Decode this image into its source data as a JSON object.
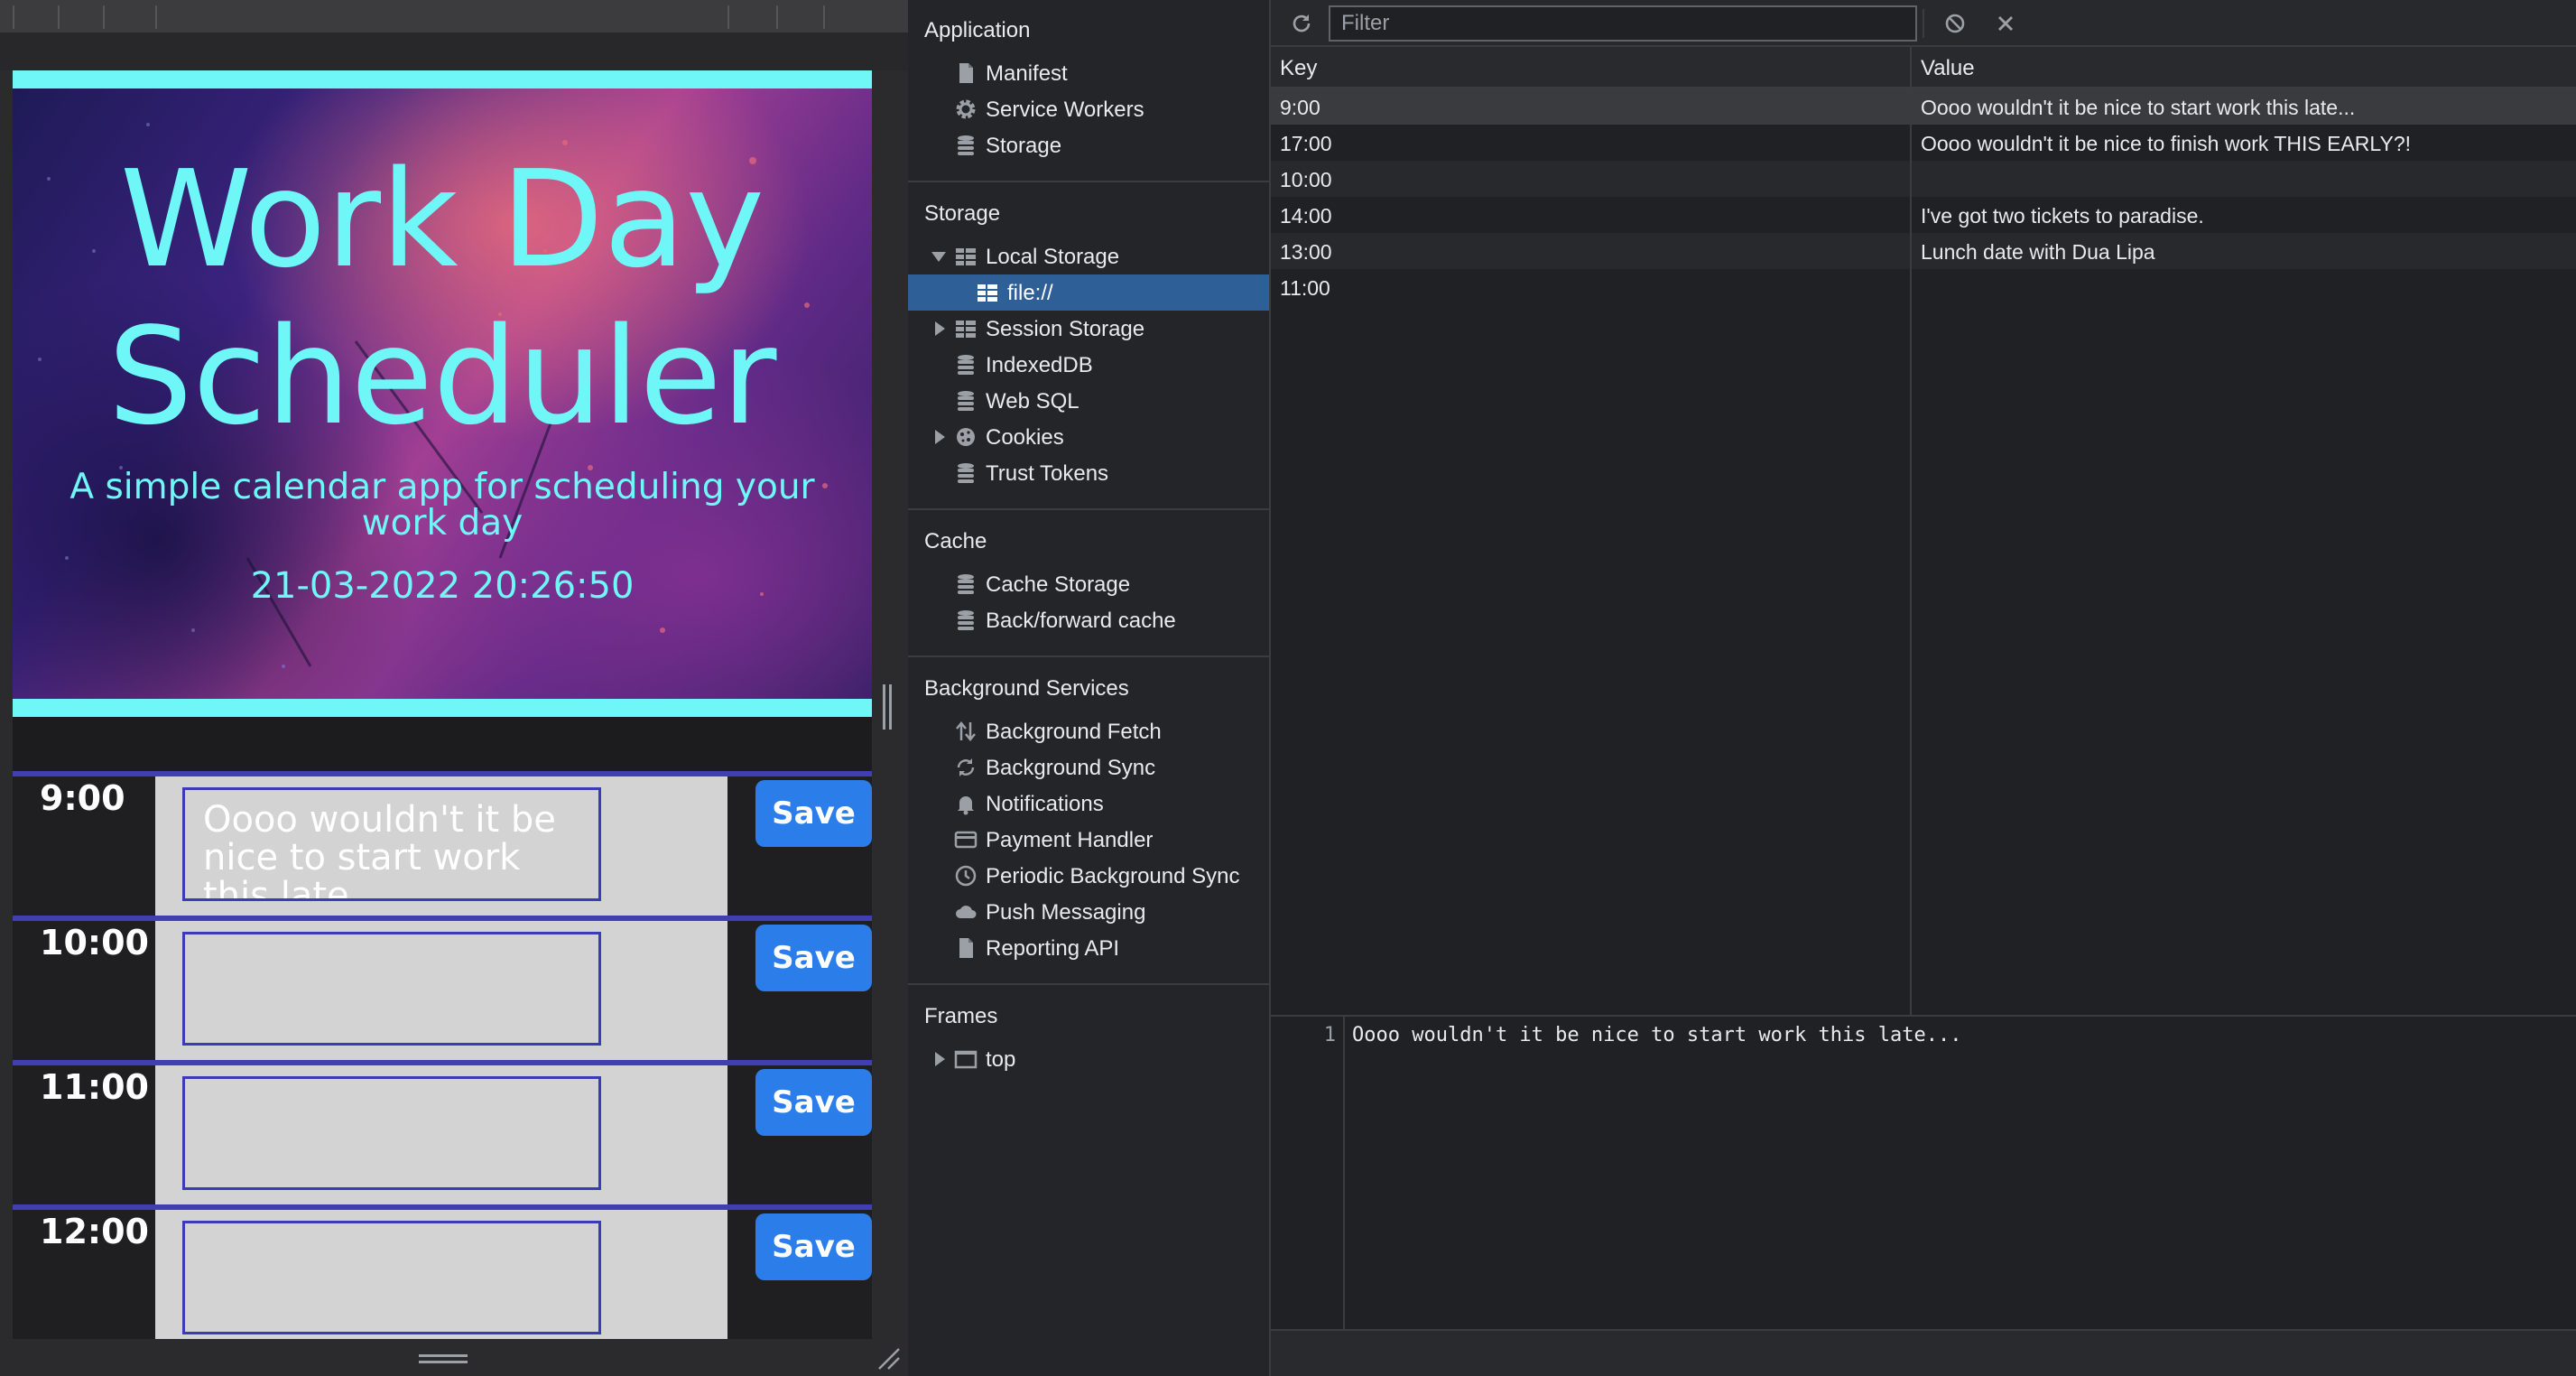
{
  "preview": {
    "hero": {
      "title_line1": "Work Day",
      "title_line2": "Scheduler",
      "subtitle": "A simple calendar app for scheduling your work day",
      "datetime": "21-03-2022 20:26:50"
    },
    "slots": [
      {
        "hour": "9:00",
        "text": "Oooo wouldn't it be nice to start work this late...",
        "save_label": "Save"
      },
      {
        "hour": "10:00",
        "text": "",
        "save_label": "Save"
      },
      {
        "hour": "11:00",
        "text": "",
        "save_label": "Save"
      },
      {
        "hour": "12:00",
        "text": "",
        "save_label": "Save"
      }
    ]
  },
  "sidebar": {
    "application": {
      "title": "Application",
      "items": [
        {
          "label": "Manifest",
          "icon": "file-icon"
        },
        {
          "label": "Service Workers",
          "icon": "gear-icon"
        },
        {
          "label": "Storage",
          "icon": "database-icon"
        }
      ]
    },
    "storage": {
      "title": "Storage",
      "local_storage": "Local Storage",
      "local_origin": "file://",
      "session_storage": "Session Storage",
      "indexeddb": "IndexedDB",
      "websql": "Web SQL",
      "cookies": "Cookies",
      "trust_tokens": "Trust Tokens"
    },
    "cache": {
      "title": "Cache",
      "items": [
        {
          "label": "Cache Storage",
          "icon": "database-icon"
        },
        {
          "label": "Back/forward cache",
          "icon": "database-icon"
        }
      ]
    },
    "background_services": {
      "title": "Background Services",
      "items": [
        {
          "label": "Background Fetch",
          "icon": "up-down-arrows-icon"
        },
        {
          "label": "Background Sync",
          "icon": "sync-icon"
        },
        {
          "label": "Notifications",
          "icon": "bell-icon"
        },
        {
          "label": "Payment Handler",
          "icon": "credit-card-icon"
        },
        {
          "label": "Periodic Background Sync",
          "icon": "clock-icon"
        },
        {
          "label": "Push Messaging",
          "icon": "cloud-icon"
        },
        {
          "label": "Reporting API",
          "icon": "file-icon"
        }
      ]
    },
    "frames": {
      "title": "Frames",
      "top": "top"
    }
  },
  "storage_view": {
    "filter_placeholder": "Filter",
    "columns": {
      "key": "Key",
      "value": "Value"
    },
    "rows": [
      {
        "key": "9:00",
        "value": "Oooo wouldn't it be nice to start work this late..."
      },
      {
        "key": "17:00",
        "value": "Oooo wouldn't it be nice to finish work THIS EARLY?!"
      },
      {
        "key": "10:00",
        "value": ""
      },
      {
        "key": "14:00",
        "value": "I've got two tickets to paradise."
      },
      {
        "key": "13:00",
        "value": "Lunch date with Dua Lipa"
      },
      {
        "key": "11:00",
        "value": ""
      }
    ],
    "selected_row": 0,
    "preview": {
      "line_number": "1",
      "text": "Oooo wouldn't it be nice to start work this late..."
    }
  },
  "colors": {
    "accent_cyan": "#6ff7f7",
    "save_blue": "#2b7de9",
    "selection_blue": "#2f5f97",
    "slot_border": "#3f3fb1"
  }
}
